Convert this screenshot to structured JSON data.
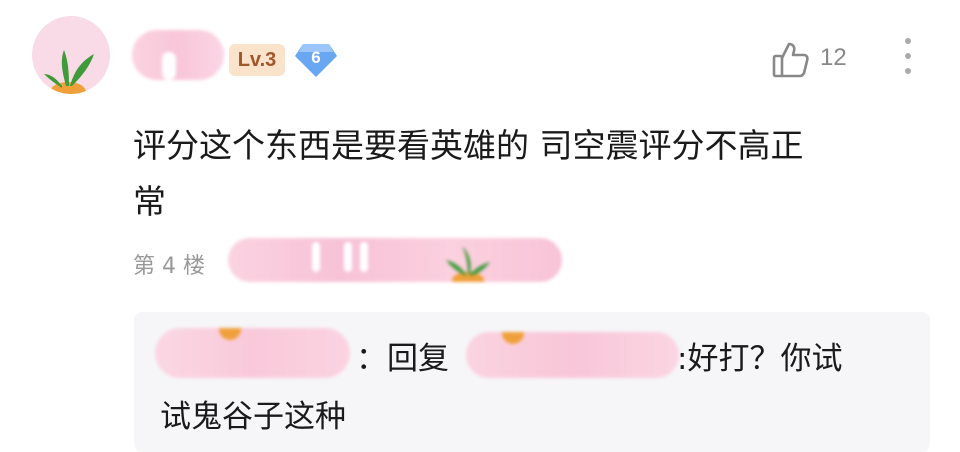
{
  "comment": {
    "level_badge": "Lv.3",
    "gem_level": "6",
    "like_count": "12",
    "text_line1": "评分这个东西是要看英雄的 司空震评分不高正",
    "text_line2": "常",
    "floor": "第 4 楼"
  },
  "reply": {
    "colon": "：",
    "reply_word": "回复",
    "tail_line1": ":好打？你试",
    "tail_line2": "试鬼谷子这种"
  },
  "icons": {
    "like": "thumbs-up-icon",
    "more": "more-vertical-icon",
    "gem": "diamond-badge-icon"
  },
  "colors": {
    "avatar_bg": "#f8dbe6",
    "blur_pink": "#f8c6d8",
    "badge_bg": "#fbe3cb",
    "badge_text": "#a0562b",
    "gem_blue": "#6aa7f2",
    "reply_bg": "#f6f6f8"
  }
}
